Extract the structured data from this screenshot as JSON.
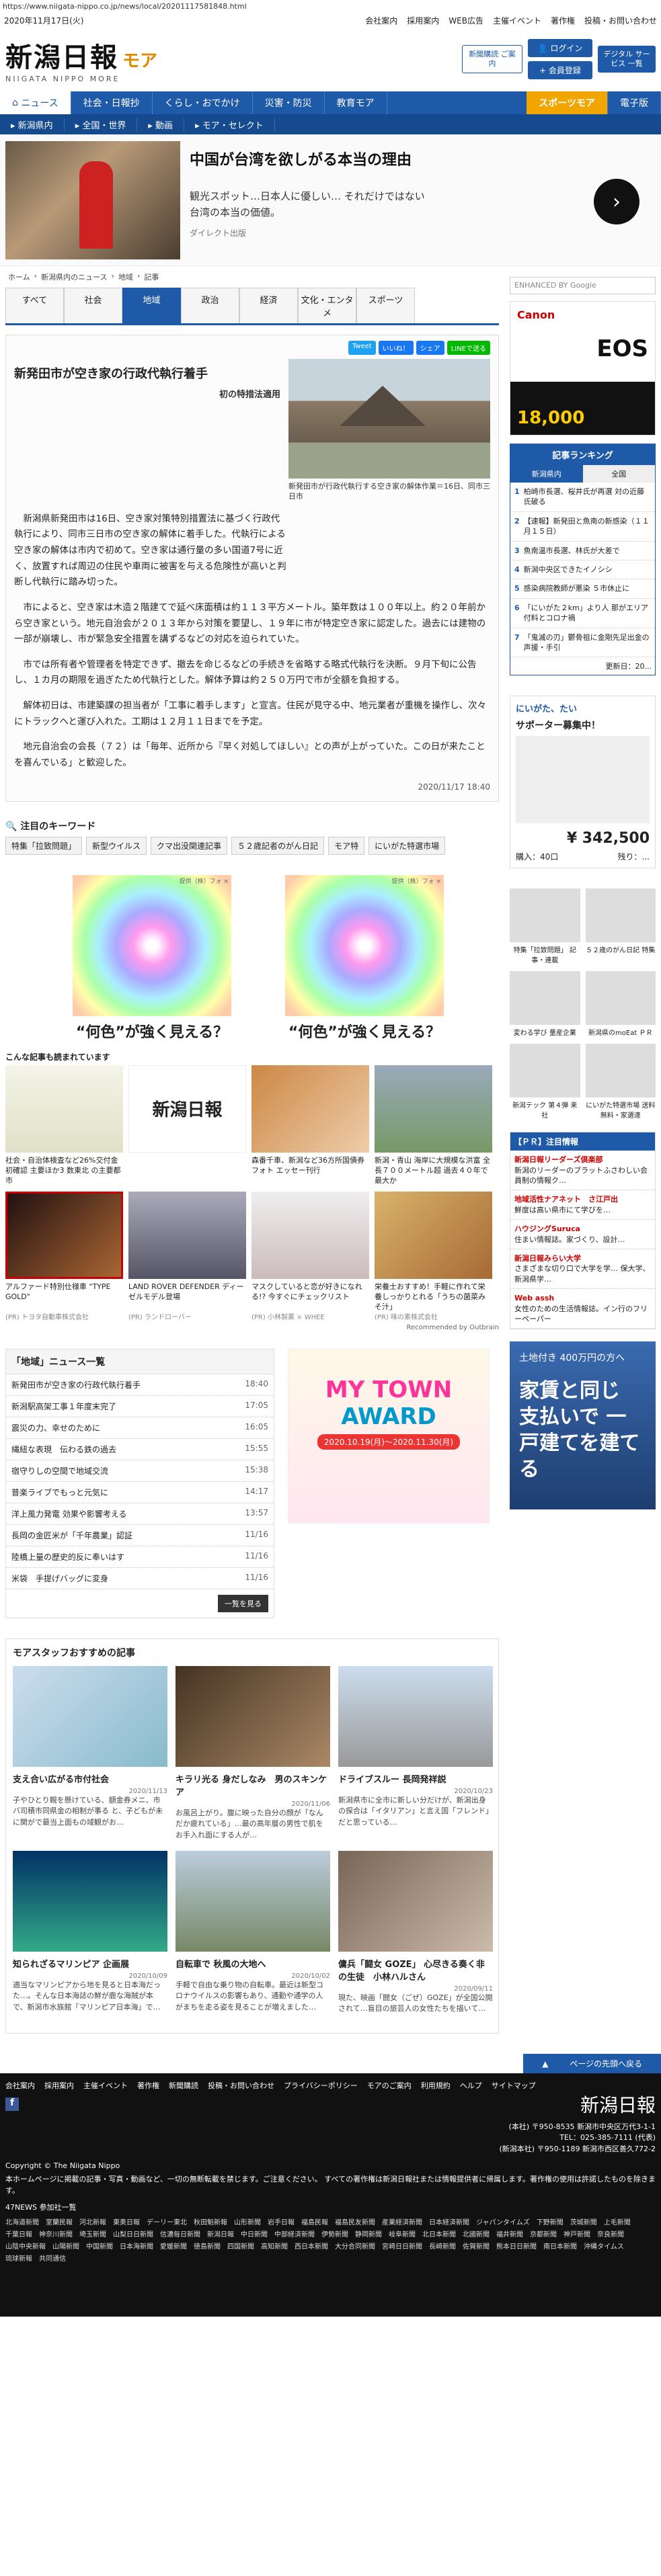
{
  "url": "https://www.niigata-nippo.co.jp/news/local/20201117581848.html",
  "date": "2020年11月17日(火)",
  "top_links": [
    "会社案内",
    "採用案内",
    "WEB広告",
    "主催イベント",
    "著作権",
    "投稿・お問い合わせ"
  ],
  "logo": {
    "jp": "新潟日報",
    "en": "NIIGATA NIPPO MORE",
    "moa": "モア"
  },
  "header_buttons": {
    "member": "新聞購読 ご案内",
    "login": "ログイン",
    "register": "会員登録",
    "digital": "デジタル サービス 一覧"
  },
  "nav1": [
    "ニュース",
    "社会・日報抄",
    "くらし・おでかけ",
    "災害・防災",
    "教育モア",
    "スポーツモア",
    "電子版"
  ],
  "nav2": [
    "新潟県内",
    "全国・世界",
    "動画",
    "モア・セレクト"
  ],
  "top_ad": {
    "title": "中国が台湾を欲しがる本当の理由",
    "body": "観光スポット…日本人に優しい… それだけではない台湾の本当の価値。",
    "sponsor": "ダイレクト出版",
    "arrow": "›"
  },
  "breadcrumb": [
    "ホーム",
    "›",
    "新潟県内のニュース",
    "›",
    "地域",
    "›",
    "記事"
  ],
  "cat_tabs": [
    "すべて",
    "社会",
    "地域",
    "政治",
    "経済",
    "文化・エンタメ",
    "スポーツ"
  ],
  "share": [
    "Tweet",
    "いいね！",
    "シェア",
    "LINEで送る"
  ],
  "article": {
    "title": "新発田市が空き家の行政代執行着手",
    "subtitle": "初の特措法適用",
    "caption": "新発田市が行政代執行する空き家の解体作業＝16日、同市三日市",
    "p1": "新潟県新発田市は16日、空き家対策特別措置法に基づく行政代執行により、同市三日市の空き家の解体に着手した。代執行による空き家の解体は市内で初めて。空き家は通行量の多い国道7号に近く、放置すれば周辺の住民や車両に被害を与える危険性が高いと判断し代執行に踏み切った。",
    "p2": "市によると、空き家は木造２階建てで延べ床面積は約１１３平方メートル。築年数は１００年以上。約２０年前から空き家という。地元自治会が２０１３年から対策を要望し、１９年に市が特定空き家に認定した。過去には建物の一部が崩壊し、市が緊急安全措置を講ずるなどの対応を迫られていた。",
    "p3": "市では所有者や管理者を特定できず、撤去を命じるなどの手続きを省略する略式代執行を決断。９月下旬に公告し、１カ月の期限を過ぎたため代執行とした。解体予算は約２５０万円で市が全額を負担する。",
    "p4": "解体初日は、市建築課の担当者が「工事に着手します」と宣言。住民が見守る中、地元業者が重機を操作し、次々にトラックへと運び入れた。工期は１２月１１日までを予定。",
    "p5": "地元自治会の会長（７２）は「毎年、近所から『早く対処してほしい』との声が上がっていた。この日が来たことを喜んでいる」と歓迎した。",
    "date": "2020/11/17 18:40"
  },
  "keywords": {
    "title": "注目のキーワード",
    "tags": [
      "特集「拉致問題」",
      "新型ウイルス",
      "クマ出没関連記事",
      "５２歳記者のがん日記",
      "モア特",
      "にいがた特選市場"
    ]
  },
  "illus": [
    {
      "pr": "提供（株）フォ ×",
      "cap": "“何色”が強く見える？"
    },
    {
      "pr": "提供（株）フォ ×",
      "cap": "“何色”が強く見える？"
    }
  ],
  "rec_title": "こんな記事も読まれています",
  "rec_items": [
    {
      "text": "社会・自治体検査など26%交付金初確認 主要ほか3 数東北 の主要都市",
      "pr": ""
    },
    {
      "text": "",
      "pr": ""
    },
    {
      "text": "森番千車、新潟など36方所国債券 フォト エッセー刊行",
      "pr": ""
    },
    {
      "text": "新潟・青山 海岸に大規模な洪富 全長７００メートル超 過去４０年で最大か",
      "pr": ""
    },
    {
      "text": "アルファード特別仕様車 \"TYPE GOLD\"",
      "pr": "(PR) トヨタ自動車株式会社"
    },
    {
      "text": "LAND ROVER DEFENDER ディーゼルモデル登場",
      "pr": "(PR) ランドローバー"
    },
    {
      "text": "マスクしていると恋が好きになれる!? 今すぐにチェックリスト",
      "pr": "(PR) 小林製薬 × WHEE"
    },
    {
      "text": "栄養士おすすめ！手軽に作れて栄養しっかりとれる「うちの菌菜みそ汁」",
      "pr": "(PR) 味の素株式会社"
    }
  ],
  "outbrain": "Recommended by Outbrain",
  "newslist": {
    "title": "「地域」ニュース一覧",
    "rows": [
      {
        "t": "新発田市が空き家の行政代執行着手",
        "d": "18:40"
      },
      {
        "t": "新潟駅高架工事１年度末完了",
        "d": "17:05"
      },
      {
        "t": "震災の力、幸せのために",
        "d": "16:05"
      },
      {
        "t": "縄紐な表現　伝わる鉄の過去",
        "d": "15:55"
      },
      {
        "t": "宿守りしの空間で地域交流",
        "d": "15:38"
      },
      {
        "t": "普楽ライブでもっと元気に",
        "d": "14:17"
      },
      {
        "t": "洋上風力発電 効果や影響考える",
        "d": "13:57"
      },
      {
        "t": "長岡の金匠米が「千年農業」認証",
        "d": "11/16"
      },
      {
        "t": "陸橋上量の歴史的反に奉いはす",
        "d": "11/16"
      },
      {
        "t": "米袋　手提げバッグに変身",
        "d": "11/16"
      }
    ],
    "more": "一覧を見る"
  },
  "mytown": {
    "a": "MY TOWN",
    "b": "AWARD",
    "c": "2020.10.19(月)〜2020.11.30(月)"
  },
  "motas": {
    "title": "モアスタッフおすすめの記事",
    "items": [
      {
        "t": "支え合い広がる市付社会",
        "d": "2020/11/13",
        "s": "子やひとり親を懸けている、額金券メニ、市バ司積市同県金の相制が事る と、子どもが未に関がで最当上面もの域観がお…"
      },
      {
        "t": "キラリ光る 身だしなみ　男のスキンケア",
        "d": "2020/11/06",
        "s": "お風呂上がり。腹に映った自分の顔が「なんだか疲れている」…最の高年層の男性で肌をお手入れ面にする人が…"
      },
      {
        "t": "ドライブスルー 長岡発祥説",
        "d": "2020/10/23",
        "s": "新潟県市に全市に新しい分だけが、新潟出身の探合は「イタリアン」と言え国「フレンド」だと思っている…"
      },
      {
        "t": "知られざるマリンピア 企画展",
        "d": "2020/10/09",
        "s": "適当なマリンピアから地を見ると日本海だった…。そんな日本海誌の鮮が鹿な海賊が本で、新潟市水族館「マリンピア日本海」で…"
      },
      {
        "t": "自転車で 秋風の大地へ",
        "d": "2020/10/02",
        "s": "手軽で自由な乗り物の自転車。最近は新型コロナウイルスの影響もあり、通勤や通学の人がまちを走る姿を見ることが増えました…"
      },
      {
        "t": "傭兵「闘女 GOZE」 心尽きる奏く非の生徒　小林ハルさん",
        "d": "2020/09/11",
        "s": "現た、映画「闘女（ごぜ）GOZE」が全国公開されて…盲目の旅芸人の女性たちを描いて…"
      }
    ]
  },
  "side": {
    "search": "ENHANCED BY Google",
    "canon": {
      "lg": "Canon",
      "eos": "EOS",
      "pr": "18,000"
    },
    "rank": {
      "title": "記事ランキング",
      "tabs": [
        "新潟県内",
        "全国"
      ],
      "items": [
        {
          "n": "1",
          "t": "柏崎市長選、桜井氏が再選 対の近藤氏破る"
        },
        {
          "n": "2",
          "t": "【速報】新発田と魚南の新感染（１１月１５日）"
        },
        {
          "n": "3",
          "t": "魚南温市長選、林氏が大差で"
        },
        {
          "n": "4",
          "t": "新潟中央区できたイノシシ"
        },
        {
          "n": "5",
          "t": "感染病院教師が悪染 ５市休止に"
        },
        {
          "n": "6",
          "t": "「にいがた２km」より人 那がエリア付料とコロナ禍"
        },
        {
          "n": "7",
          "t": "「鬼滅の刃」鬱骨祖に金剛先足出金の声援・手引"
        }
      ],
      "more": "更新日：20..."
    },
    "kifu": {
      "t": "にいがた、たい",
      "t2": "サポーター募集中！",
      "am": "¥ 342,500",
      "r1": "購入：40口",
      "r2": "残り：..."
    },
    "grid": [
      "特集「拉致問題」 記事・連載",
      "５２歳のがん日記 特集",
      "変わる学び 量産企業",
      "新潟県のmoEat ＰＲ",
      "新潟テック 第４弾 来社",
      "にいがた特選市場 送料無料・家選達"
    ],
    "pr": {
      "title": "【ＰＲ】注目情報",
      "items": [
        {
          "b": "新潟日報リーダーズ倶楽部",
          "t": "新潟のリーダーのプラットふさわしい会員制の情報ク…"
        },
        {
          "b": "地域活性ナアネット　さ江戸出",
          "t": "鮮度は高い県市にて学びを…"
        },
        {
          "b": "ハウジングSuruca",
          "t": "住まい情報誌。家づくり、設計…"
        },
        {
          "b": "新潟日報みらい大学",
          "t": "さまざまな切り口で大学を学… 保大学、新潟県学…"
        },
        {
          "b": "Web assh",
          "t": "女性のための生活情報誌。イン行のフリーペーパー"
        }
      ]
    },
    "house": {
      "a": "土地付き 400万円の方へ",
      "b": "家賃と同じ 支払いで 一戸建てを建てる"
    }
  },
  "totop": "ページの先頭へ戻る",
  "footer": {
    "links": [
      "会社案内",
      "採用案内",
      "主催イベント",
      "著作権",
      "新聞購読",
      "投稿・お問い合わせ",
      "プライバシーポリシー",
      "モアのご案内",
      "利用規約",
      "ヘルプ",
      "サイトマップ"
    ],
    "logo": "新潟日報",
    "addr1": "(本社) 〒950-8535 新潟市中央区万代3-1-1",
    "addr2": "TEL：025-385-7111 (代表)",
    "addr3": "(新潟本社) 〒950-1189 新潟市西区善久772-2",
    "copyright": "Copyright © The Niigata Nippo",
    "note": "本ホームページに掲載の記事・写真・動画など、一切の無断転載を禁じます。ご注意ください。 すべての著作権は新潟日報社または情報提供者に帰属します。著作権の使用は許諾したものを除きます。",
    "n47": "47NEWS 参加社一覧",
    "n47l": [
      "北海道新聞",
      "室蘭民報",
      "河北新報",
      "東奥日報",
      "デーリー東北",
      "秋田魁新報",
      "山形新聞",
      "岩手日報",
      "福島民報",
      "福島民友新聞",
      "産業経済新聞",
      "日本経済新聞",
      "ジャパンタイムズ",
      "下野新聞",
      "茨城新聞",
      "上毛新聞",
      "千葉日報",
      "神奈川新聞",
      "埼玉新聞",
      "山梨日日新聞",
      "信濃毎日新聞",
      "新潟日報",
      "中日新聞",
      "中部経済新聞",
      "伊勢新聞",
      "静岡新聞",
      "岐阜新聞",
      "北日本新聞",
      "北國新聞",
      "福井新聞",
      "京都新聞",
      "神戸新聞",
      "奈良新聞",
      "山陰中央新報",
      "山陽新聞",
      "中国新聞",
      "日本海新聞",
      "愛媛新聞",
      "徳島新聞",
      "四国新聞",
      "高知新聞",
      "西日本新聞",
      "大分合同新聞",
      "宮崎日日新聞",
      "長崎新聞",
      "佐賀新聞",
      "熊本日日新聞",
      "南日本新聞",
      "沖縄タイムス",
      "琉球新報",
      "共同通信"
    ]
  }
}
